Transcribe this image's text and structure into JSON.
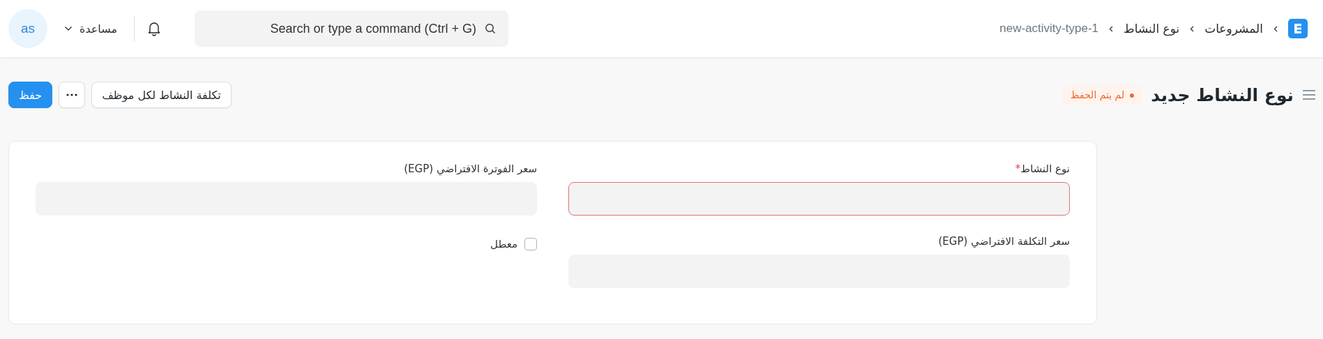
{
  "navbar": {
    "breadcrumbs": [
      {
        "label": "المشروعات",
        "current": false
      },
      {
        "label": "نوع النشاط",
        "current": false
      },
      {
        "label": "new-activity-type-1",
        "current": true
      }
    ],
    "search": {
      "placeholder": "Search or type a command (Ctrl + G)"
    },
    "help": "مساعدة",
    "avatar": "as"
  },
  "page": {
    "title": "نوع النشاط جديد",
    "status": "لم يتم الحفظ",
    "actions": [
      {
        "kind": "secondary",
        "label": "تكلفة النشاط لكل موظف"
      },
      {
        "kind": "more"
      },
      {
        "kind": "primary",
        "label": "حفظ"
      }
    ]
  },
  "form": {
    "columns": [
      [
        {
          "kind": "input",
          "label": "نوع النشاط",
          "required_mark": "*",
          "error": true
        },
        {
          "kind": "input",
          "label": "سعر التكلفة الافتراضي (EGP)",
          "error": false
        }
      ],
      [
        {
          "kind": "input",
          "label": "سعر الفوترة الافتراضي (EGP)",
          "error": false
        },
        {
          "kind": "checkbox",
          "label": "معطل",
          "checked": false
        }
      ]
    ]
  }
}
